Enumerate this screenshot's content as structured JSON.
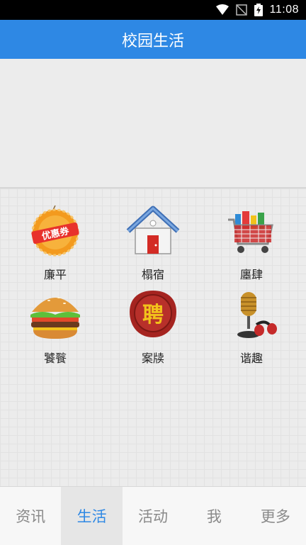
{
  "status": {
    "time": "11:08"
  },
  "header": {
    "title": "校园生活"
  },
  "grid": {
    "items": [
      {
        "label": "廉平",
        "icon": "coupon-icon"
      },
      {
        "label": "榻宿",
        "icon": "house-icon"
      },
      {
        "label": "廛肆",
        "icon": "shopping-cart-icon"
      },
      {
        "label": "饕餮",
        "icon": "burger-icon"
      },
      {
        "label": "案牍",
        "icon": "hiring-seal-icon"
      },
      {
        "label": "谐趣",
        "icon": "microphone-icon"
      }
    ],
    "coupon_text": "优惠券",
    "seal_text": "聘"
  },
  "tabs": [
    {
      "label": "资讯",
      "active": false
    },
    {
      "label": "生活",
      "active": true
    },
    {
      "label": "活动",
      "active": false
    },
    {
      "label": "我",
      "active": false
    },
    {
      "label": "更多",
      "active": false
    }
  ],
  "colors": {
    "accent": "#2e88e4",
    "status_bar": "#000000"
  }
}
